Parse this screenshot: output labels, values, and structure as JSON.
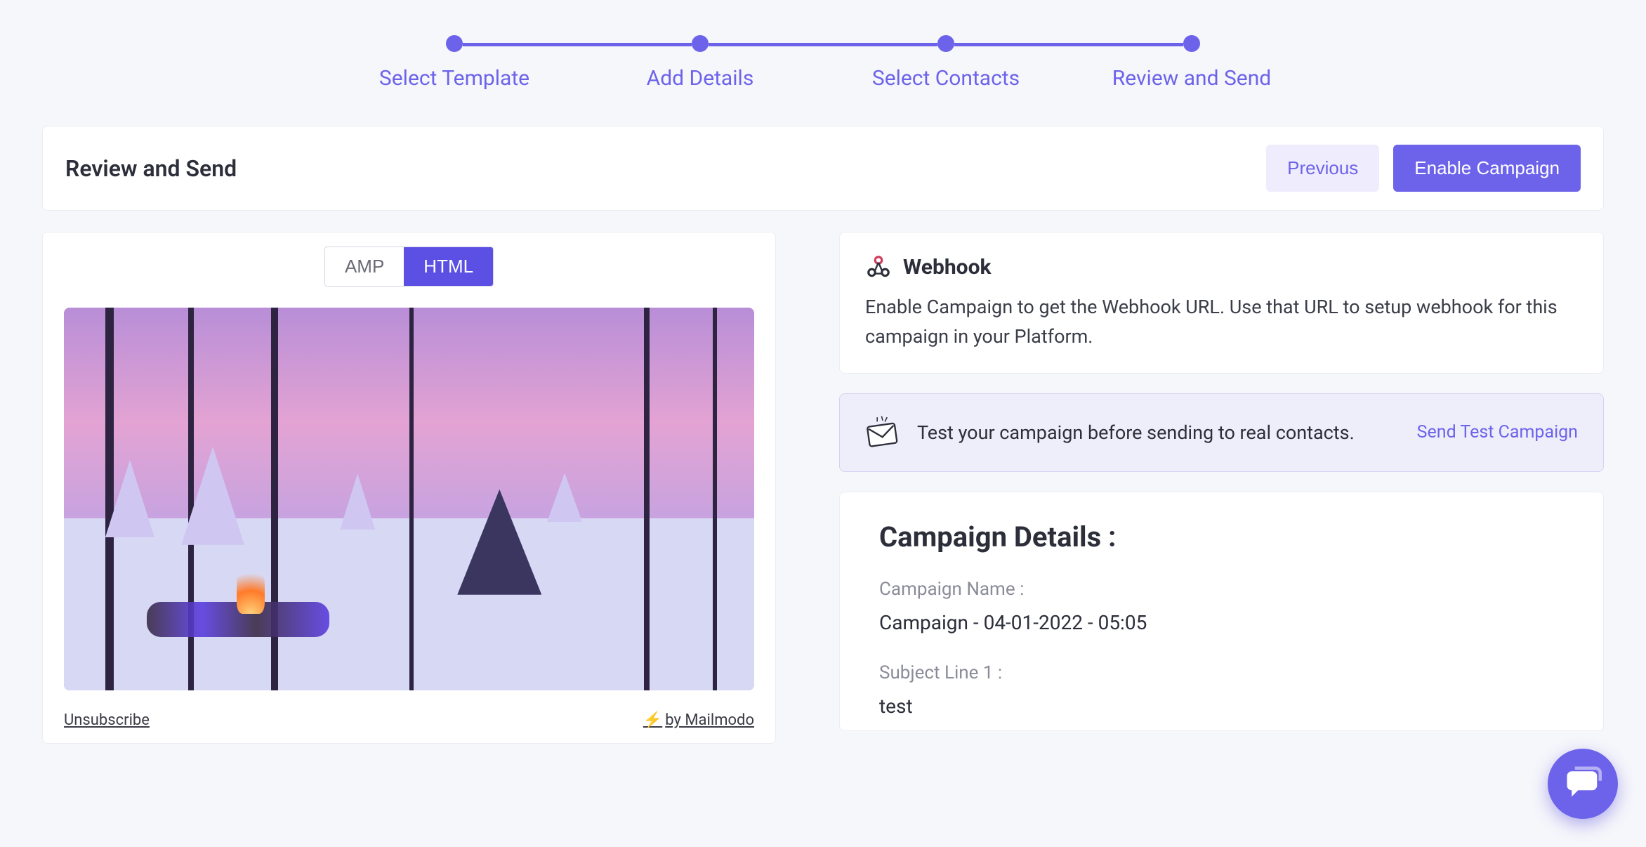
{
  "stepper": {
    "steps": [
      {
        "label": "Select Template"
      },
      {
        "label": "Add Details"
      },
      {
        "label": "Select Contacts"
      },
      {
        "label": "Review and Send"
      }
    ],
    "current": 3
  },
  "header": {
    "title": "Review and Send",
    "previous_label": "Previous",
    "enable_label": "Enable Campaign"
  },
  "preview": {
    "tabs": {
      "amp": "AMP",
      "html": "HTML",
      "active": "html"
    },
    "footer": {
      "unsubscribe": "Unsubscribe",
      "brand_prefix": "⚡",
      "brand": "by Mailmodo"
    }
  },
  "webhook": {
    "title": "Webhook",
    "body": "Enable Campaign to get the Webhook URL. Use that URL to setup webhook for this campaign in your Platform."
  },
  "test": {
    "message": "Test your campaign before sending to real contacts.",
    "link": "Send Test Campaign"
  },
  "details": {
    "heading": "Campaign Details :",
    "campaign_name_label": "Campaign Name :",
    "campaign_name_value": "Campaign - 04-01-2022 - 05:05",
    "subject_label": "Subject Line 1 :",
    "subject_value": "test"
  }
}
